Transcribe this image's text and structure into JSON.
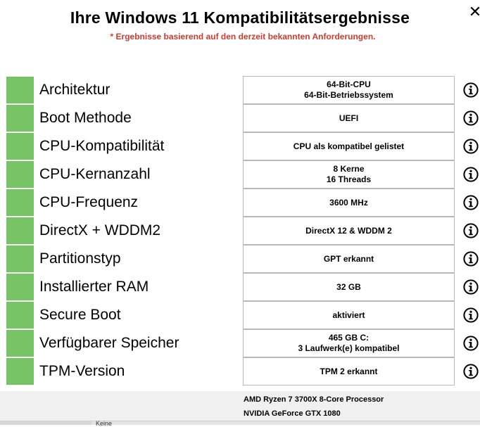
{
  "header": {
    "title": "Ihre Windows 11 Kompatibilitätsergebnisse",
    "subtitle": "* Ergebnisse basierend auf den derzeit bekannten Anforderungen.",
    "close_glyph": "✕"
  },
  "colors": {
    "pass": "#77c465",
    "warning_text": "#d03a2e"
  },
  "rows": [
    {
      "label": "Architektur",
      "value_lines": [
        "64-Bit-CPU",
        "64-Bit-Betriebssystem"
      ],
      "status": "pass",
      "info_icon": "info-circle-icon"
    },
    {
      "label": "Boot Methode",
      "value_lines": [
        "UEFI"
      ],
      "status": "pass",
      "info_icon": "info-circle-icon"
    },
    {
      "label": "CPU-Kompatibilität",
      "value_lines": [
        "CPU als kompatibel gelistet"
      ],
      "status": "pass",
      "info_icon": "info-circle-icon"
    },
    {
      "label": "CPU-Kernanzahl",
      "value_lines": [
        "8 Kerne",
        "16 Threads"
      ],
      "status": "pass",
      "info_icon": "info-circle-icon"
    },
    {
      "label": "CPU-Frequenz",
      "value_lines": [
        "3600 MHz"
      ],
      "status": "pass",
      "info_icon": "info-circle-icon"
    },
    {
      "label": "DirectX + WDDM2",
      "value_lines": [
        "DirectX 12 & WDDM 2"
      ],
      "status": "pass",
      "info_icon": "info-circle-icon"
    },
    {
      "label": "Partitionstyp",
      "value_lines": [
        "GPT erkannt"
      ],
      "status": "pass",
      "info_icon": "info-circle-icon"
    },
    {
      "label": "Installierter RAM",
      "value_lines": [
        "32 GB"
      ],
      "status": "pass",
      "info_icon": "info-circle-icon"
    },
    {
      "label": "Secure Boot",
      "value_lines": [
        "aktiviert"
      ],
      "status": "pass",
      "info_icon": "info-circle-icon"
    },
    {
      "label": "Verfügbarer Speicher",
      "value_lines": [
        "465 GB C:",
        "3 Laufwerk(e) kompatibel"
      ],
      "status": "pass",
      "info_icon": "info-circle-icon"
    },
    {
      "label": "TPM-Version",
      "value_lines": [
        "TPM 2 erkannt"
      ],
      "status": "pass",
      "info_icon": "info-circle-icon"
    }
  ],
  "footer": {
    "cpu": "AMD Ryzen 7 3700X 8-Core Processor",
    "gpu": "NVIDIA GeForce GTX 1080"
  },
  "bottom_strip": {
    "text": "Keine"
  }
}
